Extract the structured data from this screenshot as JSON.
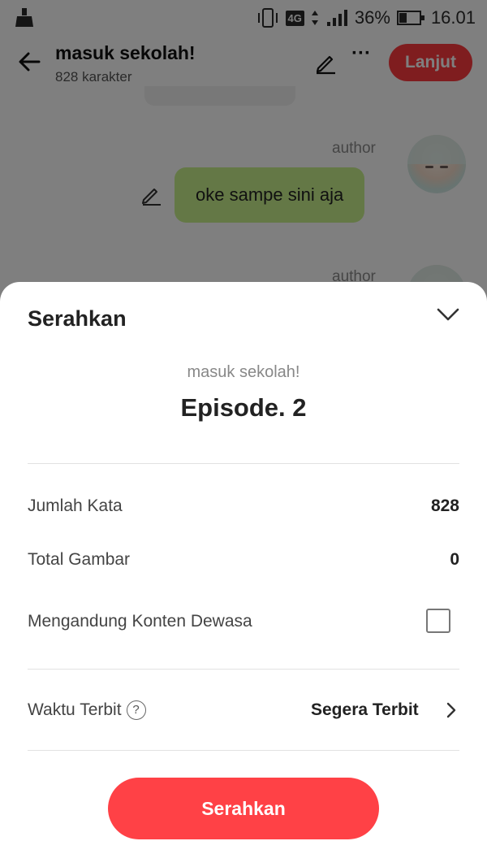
{
  "statusbar": {
    "network": "4G",
    "battery": "36%",
    "time": "16.01"
  },
  "header": {
    "title": "masuk sekolah!",
    "subtitle": "828 karakter",
    "next_label": "Lanjut",
    "more_label": "···"
  },
  "chat": {
    "messages": [
      {
        "author": "author",
        "text": "oke sampe sini aja"
      },
      {
        "author": "author"
      }
    ]
  },
  "sheet": {
    "title": "Serahkan",
    "story_name": "masuk sekolah!",
    "episode": "Episode. 2",
    "rows": [
      {
        "label": "Jumlah Kata",
        "value": "828"
      },
      {
        "label": "Total Gambar",
        "value": "0"
      },
      {
        "label": "Mengandung Konten Dewasa",
        "checked": false
      }
    ],
    "publish": {
      "label": "Waktu Terbit",
      "help": "?",
      "value": "Segera Terbit"
    },
    "submit_label": "Serahkan"
  }
}
